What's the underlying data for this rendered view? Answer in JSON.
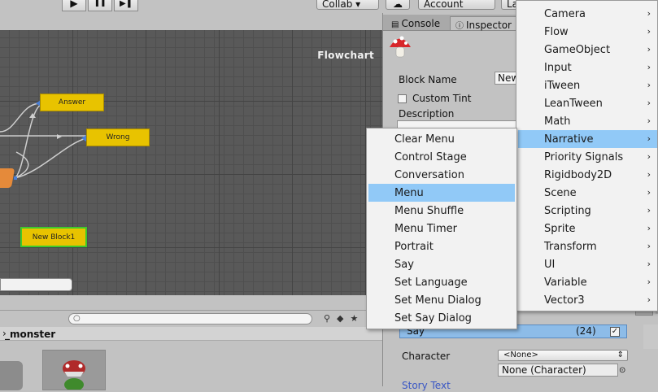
{
  "toolbar": {
    "play_icon": "play-icon",
    "pause_icon": "pause-icon",
    "step_icon": "step-icon",
    "play_glyph": "▶",
    "pause_glyph": "❚❚",
    "step_glyph": "▶❚",
    "collab_label": "Collab ▾",
    "cloud_glyph": "☁",
    "account_label": "Account",
    "layers_label": "La"
  },
  "flowchart": {
    "title": "Flowchart",
    "blocks": [
      {
        "label": "Answer"
      },
      {
        "label": "Wrong"
      },
      {
        "label": "New Block1"
      }
    ]
  },
  "project": {
    "breadcrumb": "_monster",
    "breadcrumb_sep": "›"
  },
  "inspector": {
    "tabs": {
      "console": "Console",
      "inspector": "Inspector"
    },
    "block_name_label": "Block Name",
    "block_name_value": "New",
    "custom_tint_label": "Custom Tint",
    "description_label": "Description",
    "command": {
      "name": "Say",
      "index": "(24)",
      "check": "✓"
    },
    "character_label": "Character",
    "character_dropdown": "<None>",
    "character_object": "None (Character)",
    "story_text_label": "Story Text"
  },
  "category_menu": {
    "items": [
      {
        "label": "Camera"
      },
      {
        "label": "Flow"
      },
      {
        "label": "GameObject"
      },
      {
        "label": "Input"
      },
      {
        "label": "iTween"
      },
      {
        "label": "LeanTween"
      },
      {
        "label": "Math"
      },
      {
        "label": "Narrative",
        "highlighted": true
      },
      {
        "label": "Priority Signals"
      },
      {
        "label": "Rigidbody2D"
      },
      {
        "label": "Scene"
      },
      {
        "label": "Scripting"
      },
      {
        "label": "Sprite"
      },
      {
        "label": "Transform"
      },
      {
        "label": "UI"
      },
      {
        "label": "Variable"
      },
      {
        "label": "Vector3"
      }
    ],
    "arrow": "›"
  },
  "narrative_menu": {
    "items": [
      {
        "label": "Clear Menu"
      },
      {
        "label": "Control Stage"
      },
      {
        "label": "Conversation"
      },
      {
        "label": "Menu",
        "highlighted": true
      },
      {
        "label": "Menu Shuffle"
      },
      {
        "label": "Menu Timer"
      },
      {
        "label": "Portrait"
      },
      {
        "label": "Say"
      },
      {
        "label": "Set Language"
      },
      {
        "label": "Set Menu Dialog"
      },
      {
        "label": "Set Say Dialog"
      }
    ]
  },
  "colors": {
    "highlight": "#91c9f7",
    "block_yellow": "#e8c300",
    "selected_border": "#3ec92b",
    "graph_bg": "#595959"
  }
}
